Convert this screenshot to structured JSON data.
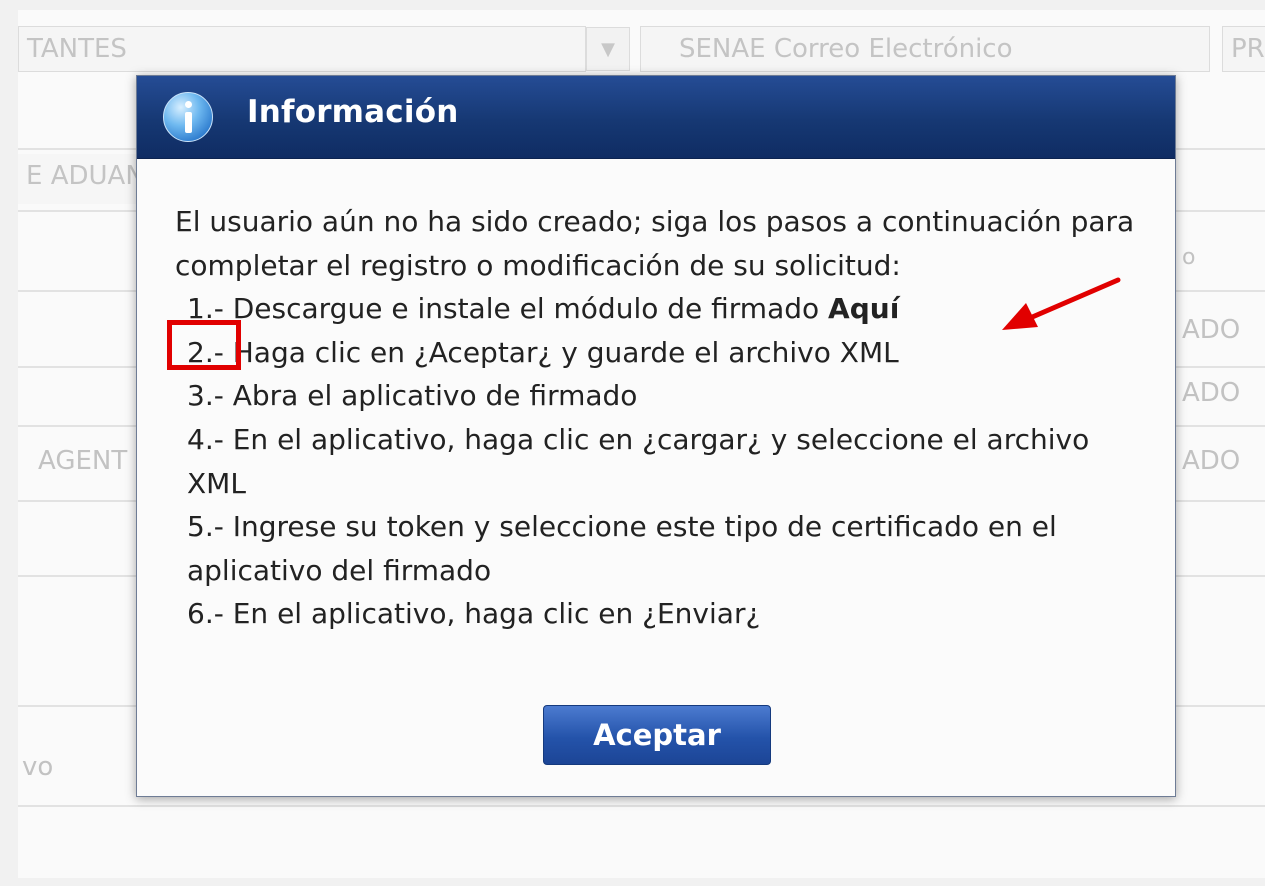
{
  "background": {
    "combo_value": "TANTES",
    "email_field": "SENAE Correo Electrónico",
    "right_field": "PR",
    "row_aduana": "E ADUAN",
    "row_agent": "AGENT",
    "row_vo": "vo",
    "col_o": "o",
    "status_1": "ADO",
    "status_2": "ADO",
    "status_3": "ADO"
  },
  "dialog": {
    "title": "Información",
    "icon": "info-icon",
    "intro": "El usuario aún no ha sido creado; siga los pasos a continuación para completar el registro o modificación de su solicitud:",
    "steps": [
      {
        "num": "1.-",
        "text": " Descargue e instale el módulo de firmado ",
        "link": "Aquí"
      },
      {
        "num": "2.-",
        "text": " Haga clic en ¿Aceptar¿ y guarde el archivo XML"
      },
      {
        "num": "3.-",
        "text": " Abra el aplicativo de firmado"
      },
      {
        "num": "4.-",
        "text": " En el aplicativo, haga clic en ¿cargar¿ y seleccione el archivo XML"
      },
      {
        "num": "5.-",
        "text": " Ingrese su token y seleccione este tipo de certificado en el aplicativo del firmado"
      },
      {
        "num": "6.-",
        "text": " En el aplicativo, haga clic en ¿Enviar¿"
      }
    ],
    "accept_label": "Aceptar"
  },
  "colors": {
    "header": "#163873",
    "button": "#2453aa",
    "annotation": "#e10000"
  }
}
